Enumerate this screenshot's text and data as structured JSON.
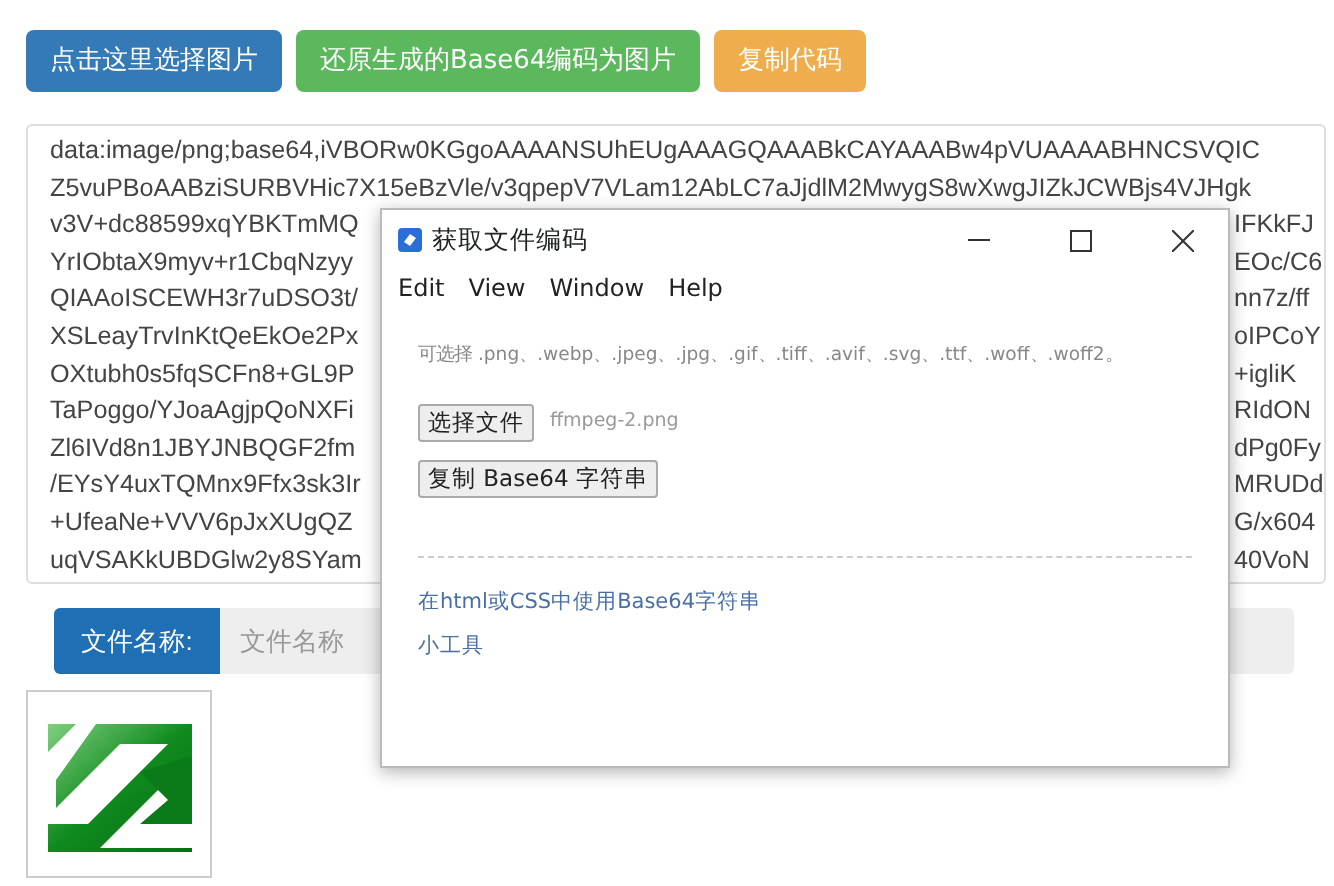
{
  "toolbar": {
    "buttons": [
      {
        "label": "点击这里选择图片",
        "kind": "primary"
      },
      {
        "label": "还原生成的Base64编码为图片",
        "kind": "success"
      },
      {
        "label": "复制代码",
        "kind": "warning"
      }
    ]
  },
  "code_area": {
    "lines": [
      {
        "left": "data:image/png;base64,iVBORw0KGgoAAAANSUhEUgAAAGQAAABkCAYAAABw4pVUAAAABHNCSVQIC"
      },
      {
        "left": "Z5vuPBoAABziSURBVHic7X15eBzVle/v3qpepV7VLam12AbLC7aJjdlM2MwygS8wXwgJIZkJCWBjs4VJHgk"
      },
      {
        "left": "v3V+dc88599xqYBKTmMQ",
        "right": "IFKkFJ"
      },
      {
        "left": "YrIObtaX9myv+r1CbqNzyy",
        "right": "EOc/C6"
      },
      {
        "left": "QIAAoISCEWH3r7uDSO3t/",
        "right": "nn7z/ff"
      },
      {
        "left": "XSLeayTrvInKtQeEkOe2Px",
        "right": "oIPCoY"
      },
      {
        "left": "OXtubh0s5fqSCFn8+GL9P",
        "right": "+igliK"
      },
      {
        "left": "TaPoggo/YJoaAgjpQoNXFi",
        "right": "RIdON"
      },
      {
        "left": "Zl6IVd8n1JBYJNBQGF2fm",
        "right": "dPg0Fy"
      },
      {
        "left": "/EYsY4uxTQMnx9Ffx3sk3Ir",
        "right": "MRUDd"
      },
      {
        "left": "+UfeaNe+VVV6pJxXUgQZ",
        "right": "G/x604"
      },
      {
        "left": "uqVSAKkUBDGlw2y8SYam",
        "right": "40VoN"
      }
    ]
  },
  "filename": {
    "label": "文件名称:",
    "placeholder": "文件名称"
  },
  "dialog": {
    "title": "获取文件编码",
    "menu": [
      "Edit",
      "View",
      "Window",
      "Help"
    ],
    "hint": "可选择 .png、.webp、.jpeg、.jpg、.gif、.tiff、.avif、.svg、.ttf、.woff、.woff2。",
    "file_button": "选择文件",
    "file_name": "ffmpeg-2.png",
    "copy_button": "复制 Base64 字符串",
    "links": [
      "在html或CSS中使用Base64字符串",
      "小工具"
    ]
  }
}
